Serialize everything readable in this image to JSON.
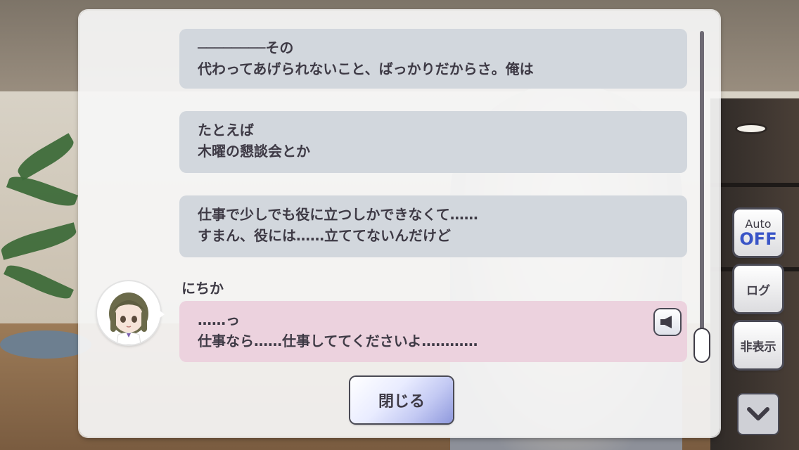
{
  "log": {
    "entries": [
      {
        "lines": [
          "────────その",
          "代わってあげられないこと、ばっかりだからさ。俺は"
        ]
      },
      {
        "lines": [
          "たとえば",
          "木曜の懇談会とか"
        ]
      },
      {
        "lines": [
          "仕事で少しでも役に立つしかできなくて……",
          "すまん、役には……立ててないんだけど"
        ]
      },
      {
        "speaker": "にちか",
        "lines": [
          "……っ",
          "仕事なら……仕事しててくださいよ…………"
        ],
        "has_voice": true
      }
    ],
    "close_label": "閉じる"
  },
  "controls": {
    "auto_label": "Auto",
    "auto_state": "OFF",
    "log_label": "ログ",
    "hide_label": "非表示"
  },
  "colors": {
    "bubble_default": "#d2d7dd",
    "bubble_highlight": "#ecd2de",
    "text": "#3e3a45",
    "auto_off": "#3a55c7"
  }
}
